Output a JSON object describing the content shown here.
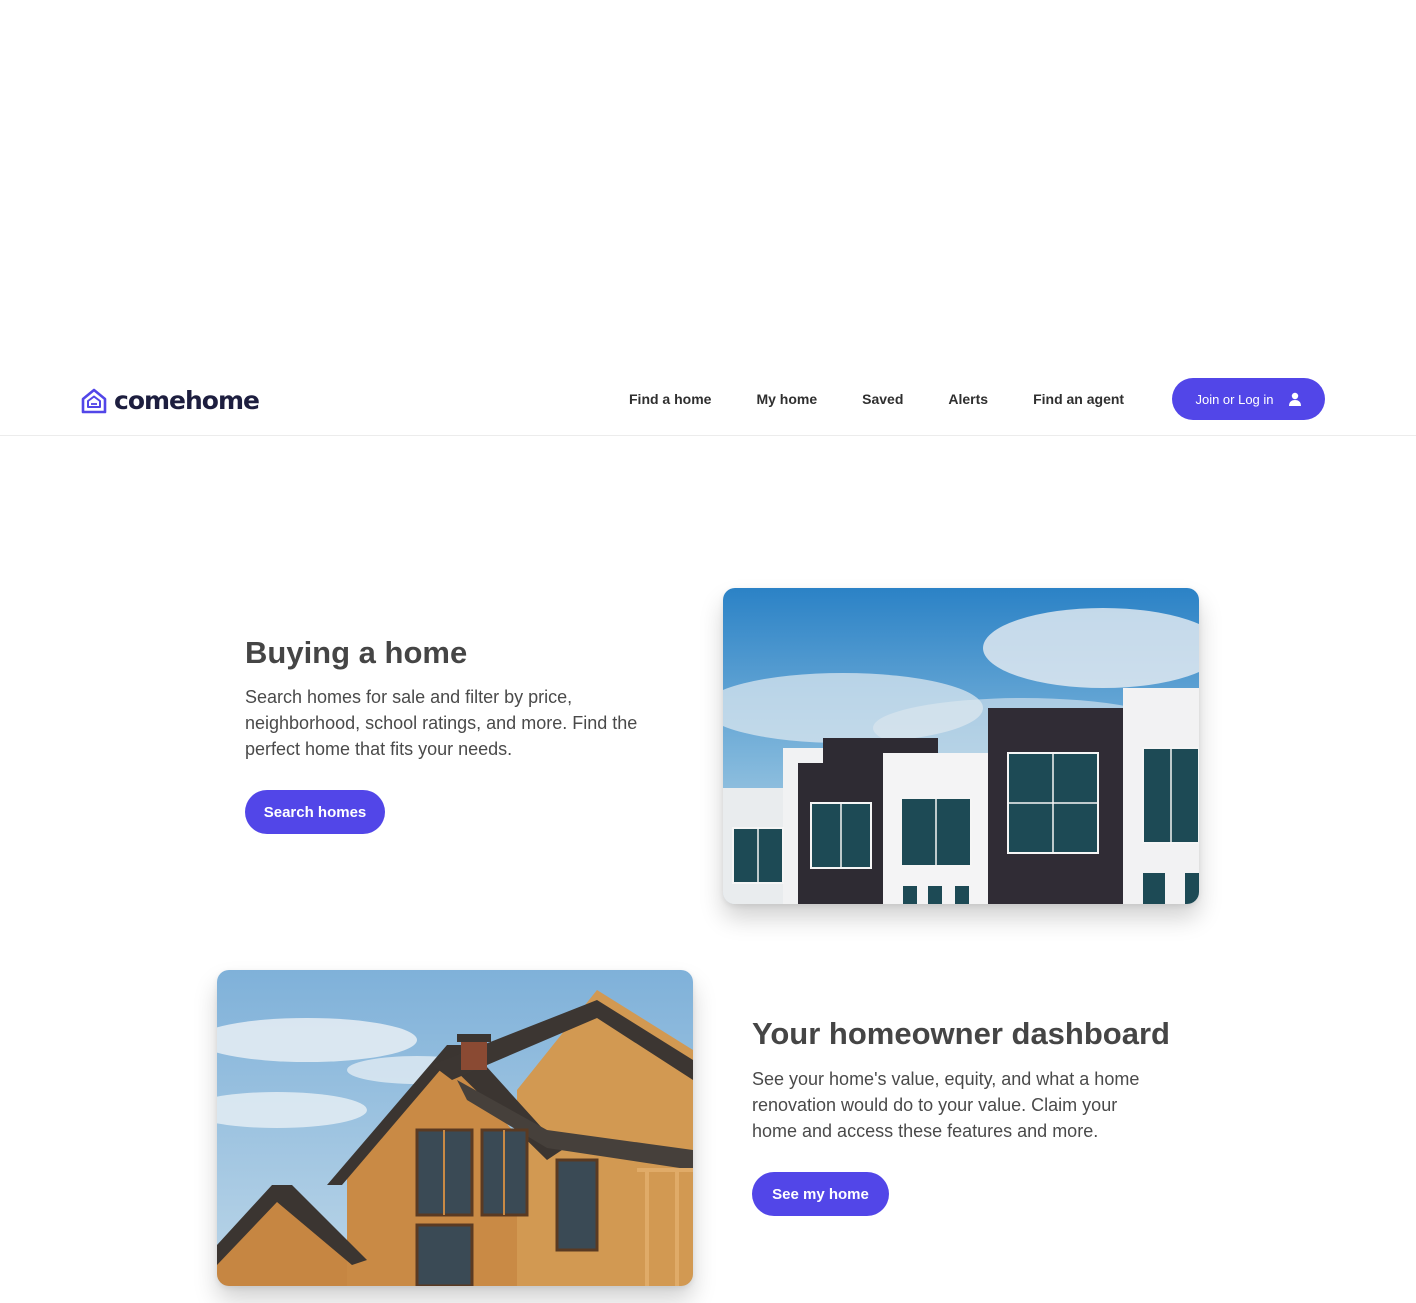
{
  "header": {
    "logo_text": "comehome",
    "nav": [
      "Find a home",
      "My home",
      "Saved",
      "Alerts",
      "Find an agent"
    ],
    "login_label": "Join or Log in"
  },
  "sections": [
    {
      "title": "Buying a home",
      "description": "Search homes for sale and filter by price, neighborhood, school ratings, and more. Find the perfect home that fits your needs.",
      "button": "Search homes"
    },
    {
      "title": "Your homeowner dashboard",
      "description": "See your home's value, equity, and what a home renovation would do to your value. Claim your home and access these features and more.",
      "button": "See my home"
    }
  ],
  "colors": {
    "accent": "#5246e8",
    "text": "#454545",
    "logo": "#1d1e3f"
  }
}
